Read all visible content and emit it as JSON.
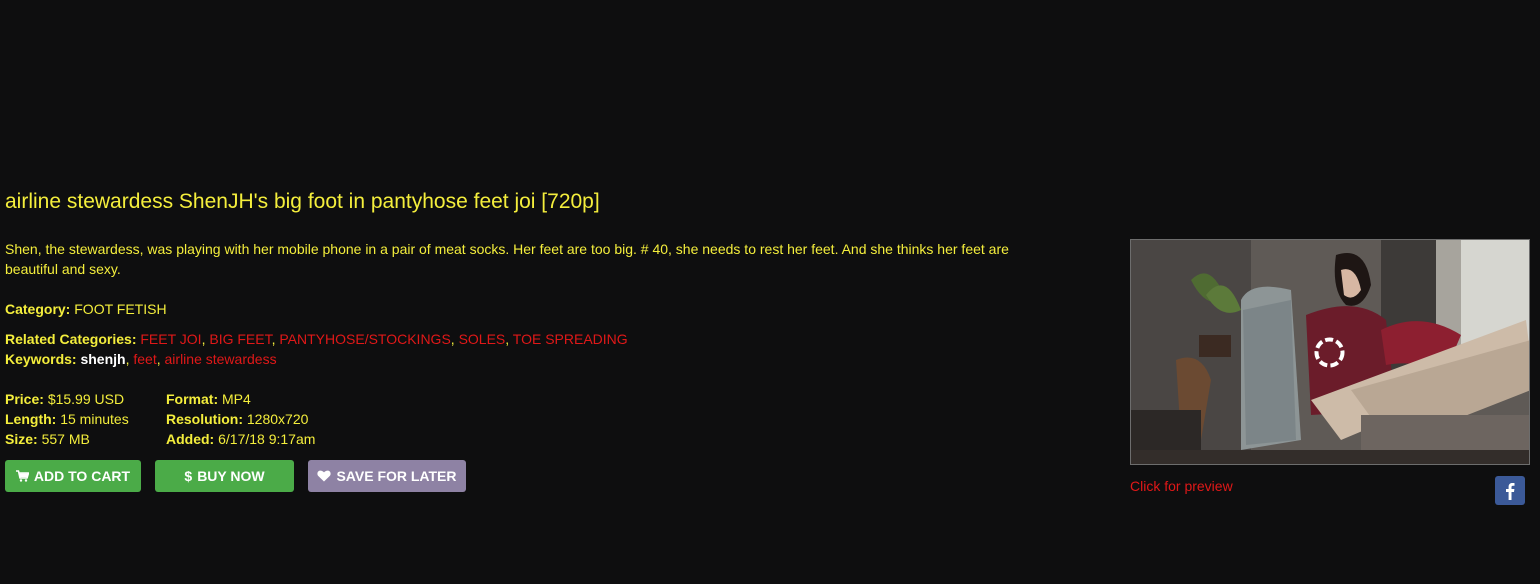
{
  "product": {
    "title": "airline stewardess ShenJH's big foot in pantyhose feet joi [720p]",
    "description": "Shen, the stewardess, was playing with her mobile phone in a pair of meat socks. Her feet are too big. # 40, she needs to rest her feet. And she thinks her feet are beautiful and sexy."
  },
  "category": {
    "label": "Category:",
    "value": "FOOT FETISH"
  },
  "related": {
    "label": "Related Categories:",
    "items": [
      "FEET JOI",
      "BIG FEET",
      "PANTYHOSE/STOCKINGS",
      "SOLES",
      "TOE SPREADING"
    ]
  },
  "keywords": {
    "label": "Keywords:",
    "items": [
      "shenjh",
      "feet",
      "airline stewardess"
    ]
  },
  "specs": {
    "price_label": "Price:",
    "price": "$15.99 USD",
    "length_label": "Length:",
    "length": "15 minutes",
    "size_label": "Size:",
    "size": "557 MB",
    "format_label": "Format:",
    "format": "MP4",
    "resolution_label": "Resolution:",
    "resolution": "1280x720",
    "added_label": "Added:",
    "added": "6/17/18 9:17am"
  },
  "buttons": {
    "add_to_cart": "ADD TO CART",
    "buy_now": "BUY NOW",
    "save_for_later": "SAVE FOR LATER",
    "cart_icon": "cart-icon",
    "dollar_icon": "$",
    "heart_icon": "heart-icon"
  },
  "preview": {
    "link_text": "Click for preview",
    "share_icon": "facebook-icon"
  },
  "colors": {
    "background": "#0e0e0f",
    "text_yellow": "#f4ee3c",
    "link_red": "#e01818",
    "button_green": "#4bab48",
    "button_purple": "#8e82a4",
    "facebook_blue": "#3b5998"
  }
}
